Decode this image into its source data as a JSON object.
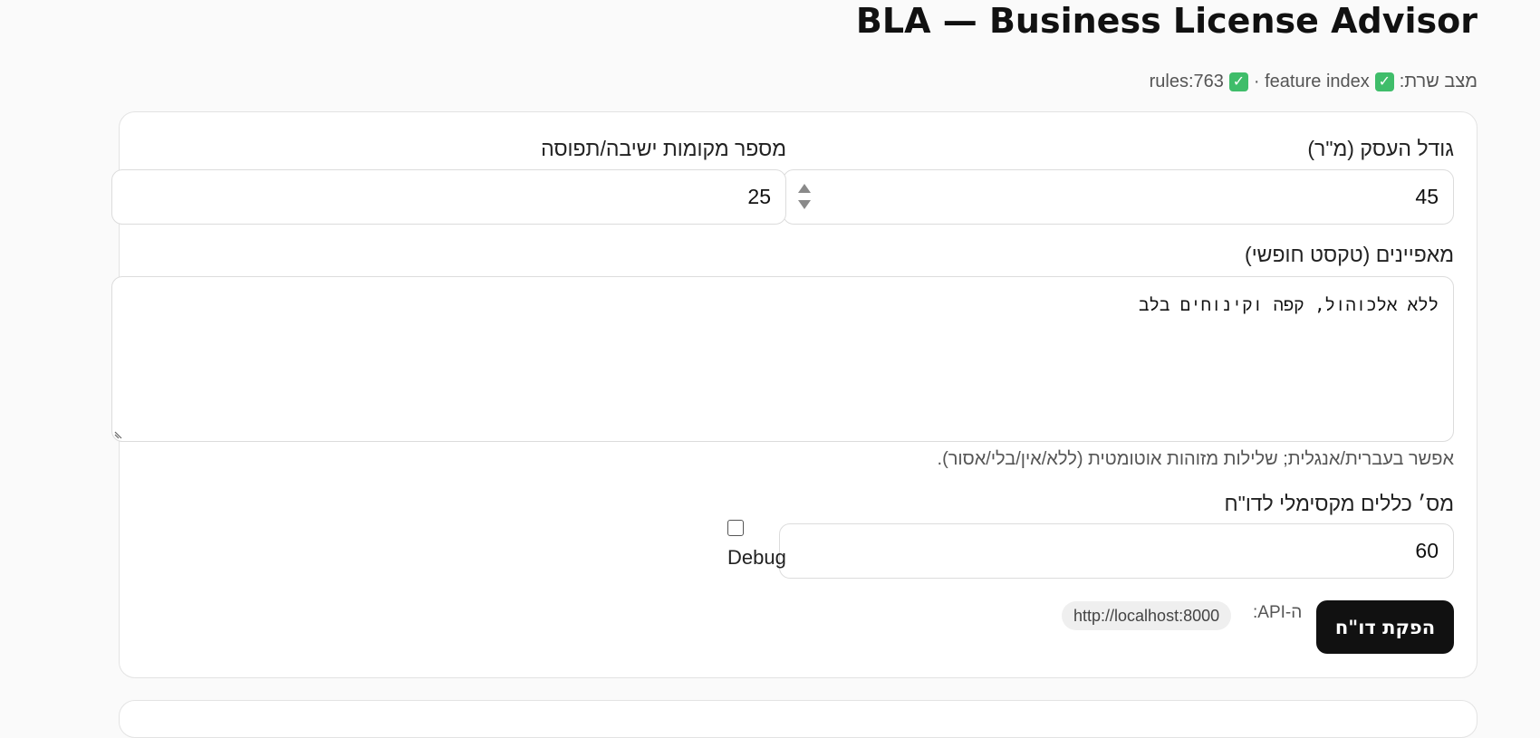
{
  "app_title": "BLA — Business License Advisor",
  "server_status": {
    "label": "מצב שרת:",
    "feature_index_label": "feature index ·",
    "rules_text": "rules:763"
  },
  "form": {
    "business_size": {
      "label": "גודל העסק (מ\"ר)",
      "value": "45"
    },
    "seats": {
      "label": "מספר מקומות ישיבה/תפוסה",
      "value": "25"
    },
    "features": {
      "label": "מאפיינים (טקסט חופשי)",
      "value": "ללא אלכוהול, קפה וקינוחים בלב",
      "hint": "אפשר בעברית/אנגלית; שלילות מזוהות אוטומטית (ללא/אין/בלי/אסור)."
    },
    "max_rules": {
      "label": "מס׳ כללים מקסימלי לדו\"ח",
      "value": "60"
    },
    "debug": {
      "label": "Debug",
      "checked": false
    },
    "submit_label": "הפקת דו\"ח",
    "api": {
      "label": "ה-API:",
      "url": "http://localhost:8000"
    }
  },
  "colors": {
    "check_green": "#3fbd6a",
    "primary_button": "#111111"
  }
}
